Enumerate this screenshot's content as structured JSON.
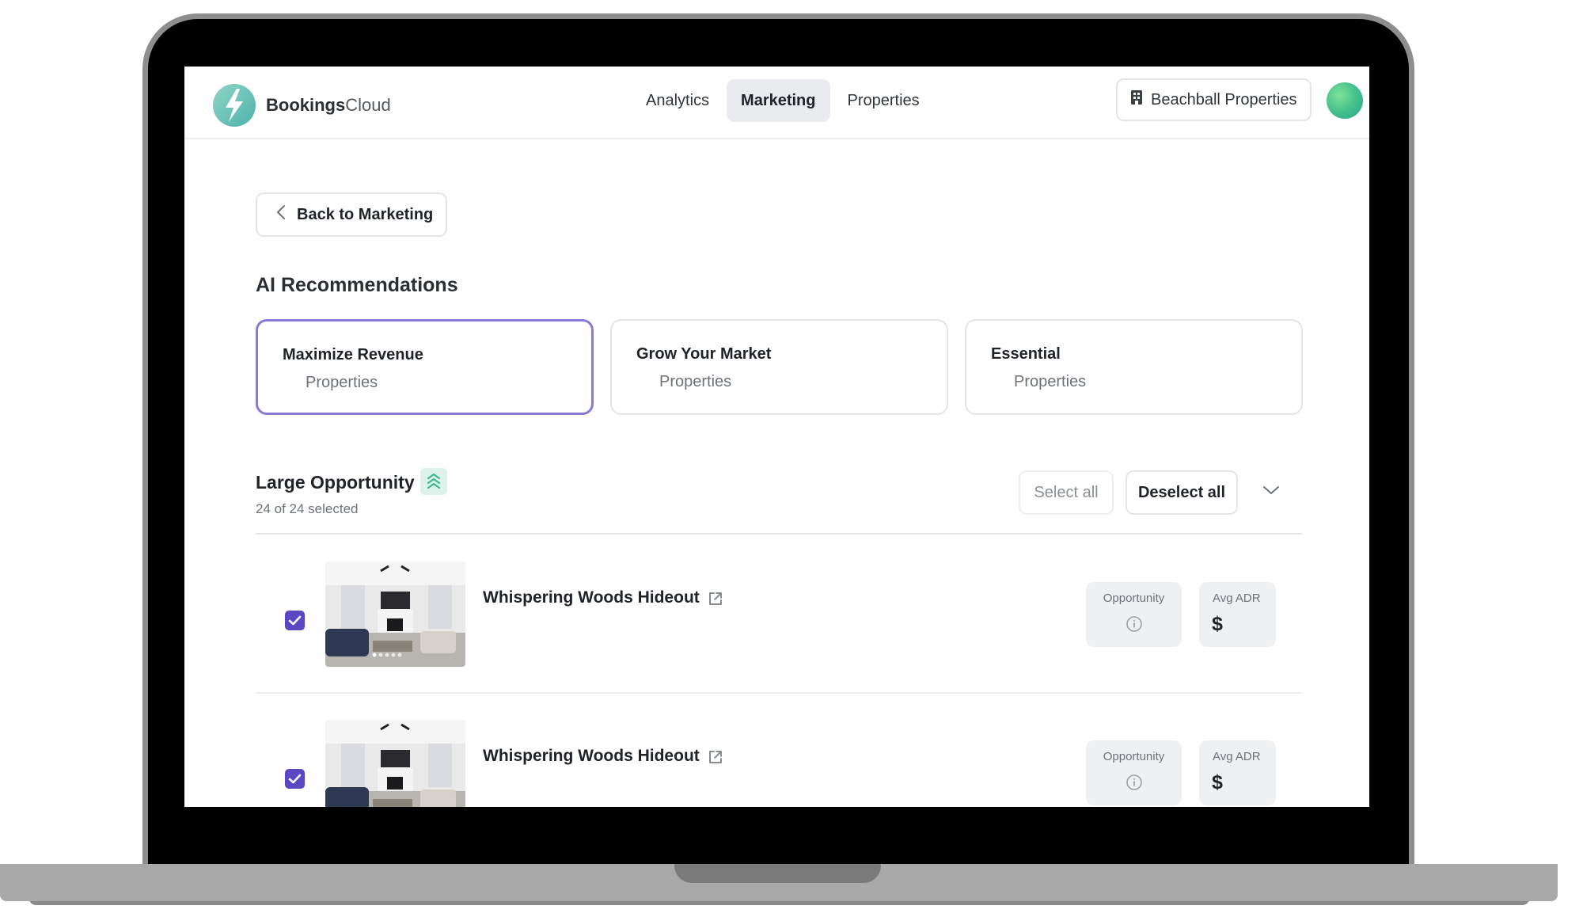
{
  "app": {
    "brand_bold": "Bookings",
    "brand_light": "Cloud"
  },
  "nav": {
    "tabs": [
      {
        "label": "Analytics"
      },
      {
        "label": "Marketing"
      },
      {
        "label": "Properties"
      }
    ],
    "active_tab": "Marketing"
  },
  "org": {
    "label": "Beachball Properties"
  },
  "back": {
    "label": "Back to Marketing"
  },
  "recommendations": {
    "title": "AI Recommendations",
    "cards": [
      {
        "title": "Maximize Revenue",
        "subtitle": "Properties"
      },
      {
        "title": "Grow Your Market",
        "subtitle": "Properties"
      },
      {
        "title": "Essential",
        "subtitle": "Properties"
      }
    ],
    "selected_card": "Maximize Revenue"
  },
  "group": {
    "title": "Large Opportunity",
    "count_text": "24 of 24 selected",
    "select_all": "Select all",
    "deselect_all": "Deselect all"
  },
  "properties": [
    {
      "name": "Whispering Woods Hideout",
      "checked": true,
      "metrics": {
        "opportunity_label": "Opportunity",
        "adr_label": "Avg ADR",
        "adr_value": "$"
      }
    },
    {
      "name": "Whispering Woods Hideout",
      "checked": true,
      "metrics": {
        "opportunity_label": "Opportunity",
        "adr_label": "Avg ADR",
        "adr_value": "$"
      }
    }
  ],
  "colors": {
    "accent": "#5b47c2",
    "selected_border": "#8a7ad6",
    "brand_teal": "#4eb2aa",
    "badge_green": "#ddf2ea"
  }
}
